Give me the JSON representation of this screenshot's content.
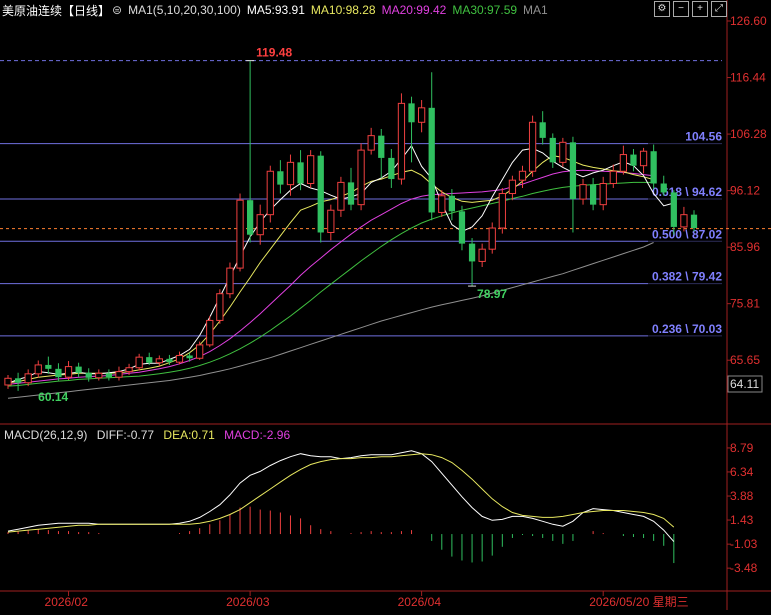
{
  "header": {
    "symbol": "美原油连续",
    "period": "【日线】",
    "settings_icon": "gear-icon",
    "ma_params": "MA1(5,10,20,30,100)",
    "ma5": "MA5:93.91",
    "ma10": "MA10:98.28",
    "ma20": "MA20:99.42",
    "ma30": "MA30:97.59",
    "ma1": "MA1",
    "buttons": [
      {
        "name": "settings-button",
        "icon": "gear-icon",
        "glyph": "⚙"
      },
      {
        "name": "minus-button",
        "icon": "minus-icon",
        "glyph": "−"
      },
      {
        "name": "plus-button",
        "icon": "plus-icon",
        "glyph": "+"
      },
      {
        "name": "maximize-button",
        "icon": "maximize-icon",
        "glyph": "⤢"
      }
    ]
  },
  "macd_header": {
    "params": "MACD(26,12,9)",
    "diff": "DIFF:-0.77",
    "dea": "DEA:0.71",
    "macd": "MACD:-2.96"
  },
  "colors": {
    "up": "#f04040",
    "down": "#30c060",
    "ma5": "#ffffff",
    "ma10": "#e8e860",
    "ma20": "#e040e0",
    "ma30": "#40c040",
    "ma100": "#909090",
    "fib_line": "#7070e0",
    "fib_text": "#8080ff",
    "current": "#ff8030",
    "high_label": "#ff4040",
    "low_label": "#40d060",
    "axis_text": "#e03030",
    "macd_params": "#dddddd",
    "dea": "#e8e860",
    "macd": "#e040e0"
  },
  "chart_data": {
    "type": "candlestick",
    "price_axis": {
      "ticks": [
        "126.60",
        "116.44",
        "106.28",
        "96.12",
        "85.96",
        "75.81",
        "65.65"
      ],
      "current_price": "64.11",
      "ylim": [
        58.5,
        126.6
      ]
    },
    "x_axis": {
      "labels": [
        "2026/02",
        "2026/03",
        "2026/04",
        "2026/05/20 星期三"
      ],
      "label_candle_index": [
        6,
        24,
        41,
        59
      ]
    },
    "annotations": {
      "high": {
        "label": "119.48",
        "value": 119.48,
        "index": 24
      },
      "low1": {
        "label": "60.14",
        "value": 60.14,
        "index": 2
      },
      "low2": {
        "label": "78.97",
        "value": 78.97,
        "index": 46
      }
    },
    "fib_levels": [
      {
        "label": "",
        "value": 119.48
      },
      {
        "label": "104.56",
        "value": 104.56
      },
      {
        "label": "0.618 \\ 94.62",
        "value": 94.62
      },
      {
        "label": "0.500 \\ 87.02",
        "value": 87.02
      },
      {
        "label": "0.382 \\ 79.42",
        "value": 79.42
      },
      {
        "label": "0.236 \\ 70.03",
        "value": 70.03
      }
    ],
    "dashed_price": 89.3,
    "candles": [
      {
        "o": 61.2,
        "c": 62.4,
        "h": 63.0,
        "l": 60.5
      },
      {
        "o": 62.4,
        "c": 61.6,
        "h": 63.4,
        "l": 60.14
      },
      {
        "o": 61.6,
        "c": 63.2,
        "h": 64.0,
        "l": 61.0
      },
      {
        "o": 63.2,
        "c": 64.8,
        "h": 65.6,
        "l": 62.5
      },
      {
        "o": 64.8,
        "c": 64.1,
        "h": 66.3,
        "l": 63.2
      },
      {
        "o": 64.1,
        "c": 62.6,
        "h": 65.1,
        "l": 62.0
      },
      {
        "o": 62.6,
        "c": 64.5,
        "h": 65.5,
        "l": 62.1
      },
      {
        "o": 64.5,
        "c": 63.4,
        "h": 65.2,
        "l": 62.6
      },
      {
        "o": 63.4,
        "c": 62.5,
        "h": 64.2,
        "l": 61.8
      },
      {
        "o": 62.5,
        "c": 63.3,
        "h": 64.0,
        "l": 62.0
      },
      {
        "o": 63.3,
        "c": 62.6,
        "h": 64.0,
        "l": 62.0
      },
      {
        "o": 62.6,
        "c": 63.6,
        "h": 64.5,
        "l": 62.0
      },
      {
        "o": 63.6,
        "c": 64.3,
        "h": 65.0,
        "l": 63.0
      },
      {
        "o": 64.3,
        "c": 66.2,
        "h": 66.8,
        "l": 63.8
      },
      {
        "o": 66.2,
        "c": 65.2,
        "h": 67.0,
        "l": 64.8
      },
      {
        "o": 65.2,
        "c": 65.9,
        "h": 66.5,
        "l": 64.6
      },
      {
        "o": 65.9,
        "c": 65.3,
        "h": 66.6,
        "l": 64.8
      },
      {
        "o": 65.3,
        "c": 66.5,
        "h": 67.2,
        "l": 64.9
      },
      {
        "o": 66.5,
        "c": 66.0,
        "h": 67.0,
        "l": 65.4
      },
      {
        "o": 66.0,
        "c": 68.4,
        "h": 69.0,
        "l": 65.7
      },
      {
        "o": 68.4,
        "c": 72.8,
        "h": 73.6,
        "l": 68.0
      },
      {
        "o": 72.8,
        "c": 77.6,
        "h": 78.4,
        "l": 72.2
      },
      {
        "o": 77.6,
        "c": 82.2,
        "h": 83.2,
        "l": 76.8
      },
      {
        "o": 82.2,
        "c": 94.4,
        "h": 95.6,
        "l": 81.6
      },
      {
        "o": 94.4,
        "c": 88.2,
        "h": 119.48,
        "l": 86.8
      },
      {
        "o": 88.2,
        "c": 91.8,
        "h": 93.6,
        "l": 86.4
      },
      {
        "o": 91.8,
        "c": 99.6,
        "h": 100.6,
        "l": 90.4
      },
      {
        "o": 99.6,
        "c": 97.2,
        "h": 101.6,
        "l": 95.6
      },
      {
        "o": 97.2,
        "c": 101.2,
        "h": 102.6,
        "l": 95.2
      },
      {
        "o": 101.2,
        "c": 97.4,
        "h": 103.4,
        "l": 96.2
      },
      {
        "o": 97.4,
        "c": 102.4,
        "h": 103.4,
        "l": 96.6
      },
      {
        "o": 102.4,
        "c": 88.6,
        "h": 103.2,
        "l": 86.8
      },
      {
        "o": 88.6,
        "c": 92.6,
        "h": 93.6,
        "l": 87.2
      },
      {
        "o": 92.6,
        "c": 97.6,
        "h": 98.6,
        "l": 91.4
      },
      {
        "o": 97.6,
        "c": 93.6,
        "h": 100.2,
        "l": 92.6
      },
      {
        "o": 93.6,
        "c": 103.4,
        "h": 104.6,
        "l": 92.6
      },
      {
        "o": 103.4,
        "c": 106.0,
        "h": 107.4,
        "l": 102.6
      },
      {
        "o": 106.0,
        "c": 102.0,
        "h": 107.2,
        "l": 98.4
      },
      {
        "o": 102.0,
        "c": 98.2,
        "h": 103.6,
        "l": 96.6
      },
      {
        "o": 98.2,
        "c": 111.8,
        "h": 113.6,
        "l": 97.2
      },
      {
        "o": 111.8,
        "c": 108.4,
        "h": 113.0,
        "l": 101.2
      },
      {
        "o": 108.4,
        "c": 111.0,
        "h": 112.4,
        "l": 106.6
      },
      {
        "o": 111.0,
        "c": 92.2,
        "h": 117.4,
        "l": 90.8
      },
      {
        "o": 92.2,
        "c": 95.2,
        "h": 96.2,
        "l": 91.4
      },
      {
        "o": 95.2,
        "c": 92.4,
        "h": 96.4,
        "l": 90.8
      },
      {
        "o": 92.4,
        "c": 86.6,
        "h": 93.4,
        "l": 85.4
      },
      {
        "o": 86.6,
        "c": 83.4,
        "h": 87.6,
        "l": 78.97
      },
      {
        "o": 83.4,
        "c": 85.6,
        "h": 86.6,
        "l": 82.4
      },
      {
        "o": 85.6,
        "c": 89.4,
        "h": 90.4,
        "l": 84.8
      },
      {
        "o": 89.4,
        "c": 95.6,
        "h": 96.6,
        "l": 88.4
      },
      {
        "o": 95.6,
        "c": 98.0,
        "h": 98.8,
        "l": 94.4
      },
      {
        "o": 98.0,
        "c": 99.6,
        "h": 100.6,
        "l": 96.6
      },
      {
        "o": 99.6,
        "c": 108.4,
        "h": 109.6,
        "l": 98.6
      },
      {
        "o": 108.4,
        "c": 105.6,
        "h": 110.4,
        "l": 104.4
      },
      {
        "o": 105.6,
        "c": 101.2,
        "h": 106.4,
        "l": 100.2
      },
      {
        "o": 101.2,
        "c": 104.8,
        "h": 105.6,
        "l": 100.4
      },
      {
        "o": 104.8,
        "c": 94.6,
        "h": 105.8,
        "l": 88.6
      },
      {
        "o": 94.6,
        "c": 97.2,
        "h": 98.2,
        "l": 93.6
      },
      {
        "o": 97.2,
        "c": 93.6,
        "h": 98.4,
        "l": 92.6
      },
      {
        "o": 93.6,
        "c": 97.4,
        "h": 98.6,
        "l": 92.6
      },
      {
        "o": 97.4,
        "c": 99.6,
        "h": 100.8,
        "l": 96.6
      },
      {
        "o": 99.6,
        "c": 102.6,
        "h": 104.2,
        "l": 99.0
      },
      {
        "o": 102.6,
        "c": 100.6,
        "h": 103.6,
        "l": 99.6
      },
      {
        "o": 100.6,
        "c": 103.2,
        "h": 103.8,
        "l": 99.2
      },
      {
        "o": 103.2,
        "c": 97.4,
        "h": 104.4,
        "l": 96.4
      },
      {
        "o": 97.4,
        "c": 95.8,
        "h": 98.8,
        "l": 95.2
      },
      {
        "o": 95.8,
        "c": 89.6,
        "h": 96.2,
        "l": 88.2
      },
      {
        "o": 89.6,
        "c": 91.8,
        "h": 93.2,
        "l": 88.8
      },
      {
        "o": 91.8,
        "c": 89.4,
        "h": 92.6,
        "l": 88.8
      }
    ],
    "ma_lines": {
      "ma5": [
        61.5,
        62.2,
        62.7,
        63.6,
        63.4,
        63.1,
        63.3,
        63.5,
        63.2,
        63.2,
        63.4,
        63.6,
        64.1,
        64.9,
        65.1,
        65.1,
        65.8,
        66.5,
        67.6,
        70.1,
        73.4,
        77.0,
        80.6,
        84.3,
        87.8,
        90.5,
        92.7,
        94.5,
        96.2,
        97.4,
        96.6,
        96.1,
        95.3,
        94.6,
        95.0,
        95.6,
        97.6,
        98.4,
        99.6,
        101.8,
        104.2,
        100.5,
        98.3,
        93.8,
        90.0,
        88.8,
        89.6,
        91.6,
        95.0,
        98.1,
        101.2,
        103.4,
        103.7,
        102.9,
        101.4,
        100.3,
        99.4,
        98.6,
        99.3,
        99.8,
        100.6,
        101.3,
        100.6,
        98.8,
        95.6,
        93.4,
        93.9
      ],
      "ma10": [
        61.6,
        61.8,
        62.2,
        62.6,
        62.8,
        63.0,
        63.1,
        63.3,
        63.3,
        63.3,
        63.3,
        63.4,
        63.6,
        63.9,
        64.2,
        64.6,
        65.2,
        65.9,
        67.0,
        68.4,
        70.4,
        72.7,
        75.2,
        77.9,
        80.5,
        83.2,
        85.6,
        88.0,
        90.4,
        92.6,
        93.3,
        94.1,
        94.5,
        95.1,
        95.8,
        96.9,
        97.8,
        98.2,
        98.8,
        99.4,
        99.8,
        98.9,
        97.3,
        95.9,
        94.9,
        94.2,
        94.0,
        94.2,
        94.4,
        95.2,
        96.4,
        97.8,
        99.6,
        101.2,
        102.4,
        102.1,
        101.4,
        100.7,
        100.3,
        100.0,
        99.7,
        99.5,
        99.0,
        98.6,
        98.1
      ],
      "ma20": [
        61.3,
        61.5,
        61.7,
        61.9,
        62.1,
        62.3,
        62.4,
        62.6,
        62.7,
        62.8,
        62.9,
        63.1,
        63.3,
        63.5,
        63.8,
        64.1,
        64.5,
        65.0,
        65.6,
        66.3,
        67.2,
        68.3,
        69.5,
        70.9,
        72.4,
        74.0,
        75.7,
        77.4,
        79.1,
        80.9,
        82.5,
        84.0,
        85.5,
        86.9,
        88.3,
        89.6,
        90.8,
        91.8,
        92.8,
        93.8,
        94.6,
        95.1,
        95.4,
        95.5,
        95.6,
        95.7,
        95.8,
        95.9,
        96.1,
        96.3,
        96.8,
        97.3,
        97.9,
        98.5,
        99.1,
        99.5,
        99.7,
        99.8,
        99.7,
        99.6,
        99.5,
        99.4,
        99.2,
        99.0,
        98.8
      ],
      "ma30": [
        61.0,
        61.1,
        61.3,
        61.5,
        61.7,
        61.9,
        62.0,
        62.2,
        62.3,
        62.4,
        62.5,
        62.6,
        62.7,
        62.8,
        63.0,
        63.2,
        63.5,
        63.8,
        64.2,
        64.7,
        65.3,
        66.0,
        66.8,
        67.7,
        68.7,
        69.8,
        71.0,
        72.3,
        73.6,
        75.0,
        76.4,
        77.9,
        79.3,
        80.7,
        82.1,
        83.5,
        84.8,
        86.1,
        87.3,
        88.4,
        89.4,
        90.3,
        91.0,
        91.6,
        92.1,
        92.6,
        93.0,
        93.4,
        93.8,
        94.2,
        94.7,
        95.1,
        95.6,
        96.0,
        96.4,
        96.7,
        96.9,
        97.1,
        97.2,
        97.3,
        97.4,
        97.5,
        97.6,
        97.6,
        97.59
      ],
      "ma100": [
        58.8,
        59.0,
        59.2,
        59.4,
        59.6,
        59.8,
        60.0,
        60.2,
        60.4,
        60.6,
        60.8,
        61.0,
        61.2,
        61.4,
        61.6,
        61.8,
        62.0,
        62.3,
        62.6,
        62.9,
        63.3,
        63.7,
        64.1,
        64.6,
        65.1,
        65.6,
        66.1,
        66.7,
        67.3,
        67.9,
        68.5,
        69.1,
        69.7,
        70.3,
        70.9,
        71.5,
        72.1,
        72.7,
        73.2,
        73.7,
        74.2,
        74.7,
        75.2,
        75.6,
        76.0,
        76.4,
        76.8,
        77.2,
        77.7,
        78.2,
        78.7,
        79.2,
        79.7,
        80.2,
        80.7,
        81.2,
        81.8,
        82.4,
        83.0,
        83.6,
        84.2,
        84.8,
        85.4,
        86.0,
        86.8
      ]
    },
    "macd_panel": {
      "axis_ticks": [
        "8.79",
        "6.34",
        "3.88",
        "1.43",
        "-1.03",
        "-3.48"
      ],
      "ylim": [
        -5.2,
        9.6
      ],
      "diff": [
        0.3,
        0.5,
        0.7,
        0.9,
        1.0,
        1.1,
        1.1,
        1.1,
        1.1,
        1.0,
        1.0,
        1.0,
        1.0,
        1.0,
        1.0,
        1.0,
        1.0,
        1.1,
        1.3,
        1.7,
        2.3,
        3.0,
        4.0,
        5.2,
        6.0,
        6.4,
        7.0,
        7.5,
        7.9,
        8.2,
        8.0,
        7.9,
        7.9,
        7.7,
        7.8,
        8.0,
        8.1,
        8.1,
        8.1,
        8.3,
        8.5,
        8.2,
        7.4,
        6.2,
        5.0,
        3.8,
        2.7,
        1.8,
        1.4,
        1.5,
        1.8,
        1.8,
        1.6,
        1.3,
        1.0,
        0.8,
        1.3,
        2.2,
        2.6,
        2.5,
        2.4,
        2.2,
        2.0,
        1.8,
        1.3,
        0.4,
        -0.77
      ],
      "dea": [
        0.2,
        0.3,
        0.4,
        0.5,
        0.6,
        0.7,
        0.8,
        0.9,
        0.9,
        1.0,
        1.0,
        1.0,
        1.0,
        1.0,
        1.0,
        1.0,
        1.0,
        1.0,
        1.0,
        1.1,
        1.3,
        1.6,
        2.0,
        2.5,
        3.2,
        3.9,
        4.6,
        5.3,
        6.0,
        6.6,
        7.1,
        7.4,
        7.6,
        7.7,
        7.7,
        7.8,
        7.8,
        7.9,
        7.9,
        8.0,
        8.1,
        8.2,
        8.1,
        7.8,
        7.3,
        6.5,
        5.6,
        4.6,
        3.6,
        2.8,
        2.2,
        1.9,
        1.8,
        1.7,
        1.7,
        1.8,
        2.0,
        2.2,
        2.3,
        2.4,
        2.4,
        2.4,
        2.3,
        2.2,
        2.0,
        1.6,
        0.71
      ],
      "hist": [
        0.2,
        0.3,
        0.4,
        0.5,
        0.4,
        0.3,
        0.3,
        0.2,
        0.2,
        0.1,
        0.0,
        0.0,
        0.0,
        0.0,
        0.0,
        0.0,
        0.0,
        0.1,
        0.3,
        0.6,
        1.0,
        1.4,
        2.0,
        2.7,
        2.8,
        2.5,
        2.4,
        2.2,
        1.9,
        1.6,
        0.9,
        0.5,
        0.3,
        0.0,
        0.1,
        0.2,
        0.3,
        0.2,
        0.2,
        0.3,
        0.4,
        0.0,
        -0.7,
        -1.6,
        -2.3,
        -2.7,
        -2.9,
        -2.8,
        -2.2,
        -1.3,
        -0.4,
        -0.1,
        -0.2,
        -0.4,
        -0.7,
        -1.0,
        -0.7,
        0.0,
        0.3,
        0.1,
        0.0,
        -0.2,
        -0.3,
        -0.4,
        -0.7,
        -1.2,
        -2.96
      ]
    }
  }
}
